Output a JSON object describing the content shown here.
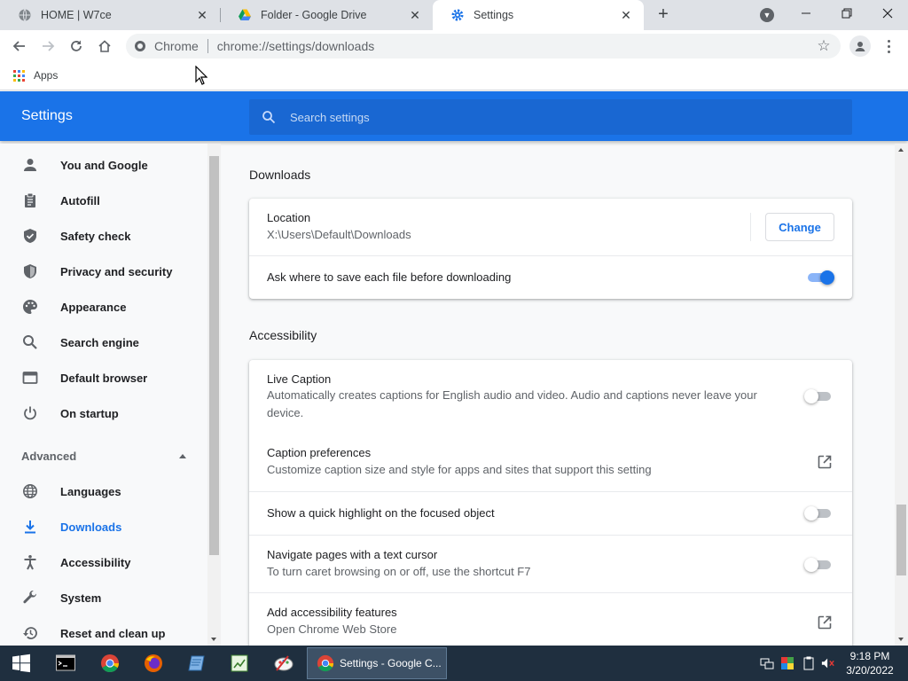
{
  "tabs": [
    {
      "title": "HOME | W7ce",
      "active": false
    },
    {
      "title": "Folder - Google Drive",
      "active": false
    },
    {
      "title": "Settings",
      "active": true
    }
  ],
  "toolbar": {
    "origin": "Chrome",
    "url": "chrome://settings/downloads"
  },
  "bookmarks": {
    "apps_label": "Apps"
  },
  "header": {
    "title": "Settings",
    "search_placeholder": "Search settings"
  },
  "sidebar": {
    "items": [
      {
        "label": "You and Google",
        "icon": "person-icon"
      },
      {
        "label": "Autofill",
        "icon": "clipboard-icon"
      },
      {
        "label": "Safety check",
        "icon": "shield-check-icon"
      },
      {
        "label": "Privacy and security",
        "icon": "shield-icon"
      },
      {
        "label": "Appearance",
        "icon": "palette-icon"
      },
      {
        "label": "Search engine",
        "icon": "search-icon"
      },
      {
        "label": "Default browser",
        "icon": "browser-window-icon"
      },
      {
        "label": "On startup",
        "icon": "power-icon"
      }
    ],
    "advanced_label": "Advanced",
    "advanced_items": [
      {
        "label": "Languages",
        "icon": "globe-icon"
      },
      {
        "label": "Downloads",
        "icon": "download-icon",
        "selected": true
      },
      {
        "label": "Accessibility",
        "icon": "accessibility-icon"
      },
      {
        "label": "System",
        "icon": "wrench-icon"
      },
      {
        "label": "Reset and clean up",
        "icon": "restore-icon"
      }
    ]
  },
  "downloads": {
    "title": "Downloads",
    "location_label": "Location",
    "location_path": "X:\\Users\\Default\\Downloads",
    "change_label": "Change",
    "ask_label": "Ask where to save each file before downloading",
    "ask_enabled": true
  },
  "accessibility": {
    "title": "Accessibility",
    "live_caption_label": "Live Caption",
    "live_caption_desc": "Automatically creates captions for English audio and video. Audio and captions never leave your device.",
    "live_caption_enabled": false,
    "caption_prefs_label": "Caption preferences",
    "caption_prefs_desc": "Customize caption size and style for apps and sites that support this setting",
    "highlight_label": "Show a quick highlight on the focused object",
    "highlight_enabled": false,
    "caret_label": "Navigate pages with a text cursor",
    "caret_desc": "To turn caret browsing on or off, use the shortcut F7",
    "caret_enabled": false,
    "add_features_label": "Add accessibility features",
    "add_features_desc": "Open Chrome Web Store"
  },
  "taskbar": {
    "active_task": "Settings - Google C...",
    "time": "9:18 PM",
    "date": "3/20/2022"
  },
  "colors": {
    "accent": "#1a73e8",
    "header": "#1a73e8",
    "taskbar": "#1f2f3f"
  }
}
